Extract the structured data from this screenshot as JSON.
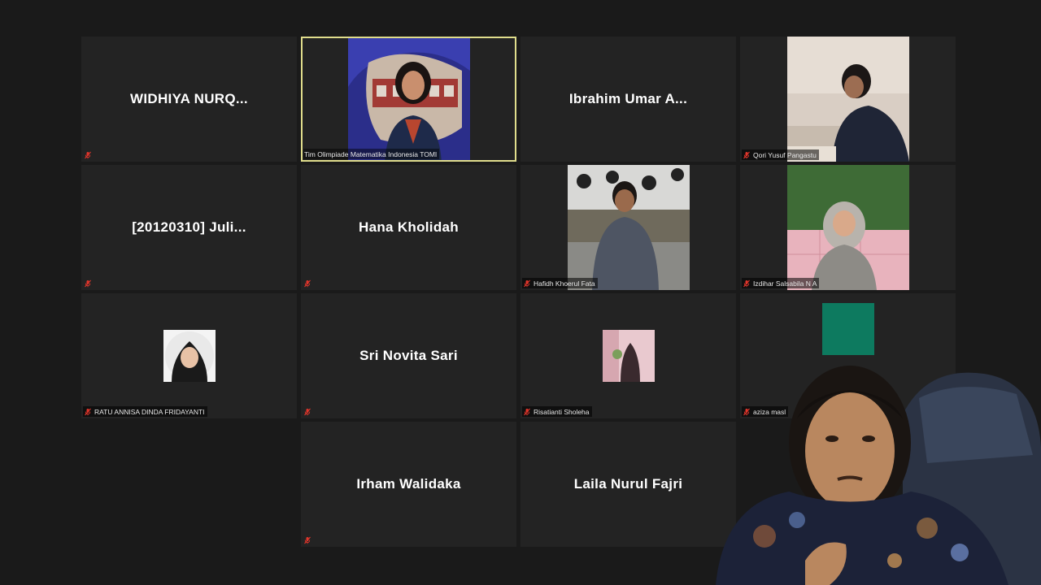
{
  "participants": [
    {
      "display_name": "WIDHIYA  NURQ..."
    },
    {
      "label": "Tim Olimpiade Matematika Indonesia TOMI"
    },
    {
      "display_name": "Ibrahim Umar A..."
    },
    {
      "label": "Qori Yusuf Pangastu"
    },
    {
      "display_name": "[20120310]  Juli..."
    },
    {
      "display_name": "Hana Kholidah"
    },
    {
      "label": "Hafidh Khoerul Fata"
    },
    {
      "label": "Izdihar Salsabila N A"
    },
    {
      "label": "RATU ANNISA DINDA FRIDAYANTI"
    },
    {
      "display_name": "Sri Novita Sari"
    },
    {
      "label": "Risatianti Sholeha"
    },
    {
      "label": "aziza masl"
    },
    {
      "display_name": "Irham Walidaka"
    },
    {
      "display_name": "Laila Nurul Fajri"
    }
  ],
  "colors": {
    "background": "#1a1a1a",
    "tile": "#232323",
    "active_speaker_border": "#e0dd8c",
    "muted_icon": "#e0352b"
  },
  "icons": [
    "mic-muted-icon"
  ]
}
